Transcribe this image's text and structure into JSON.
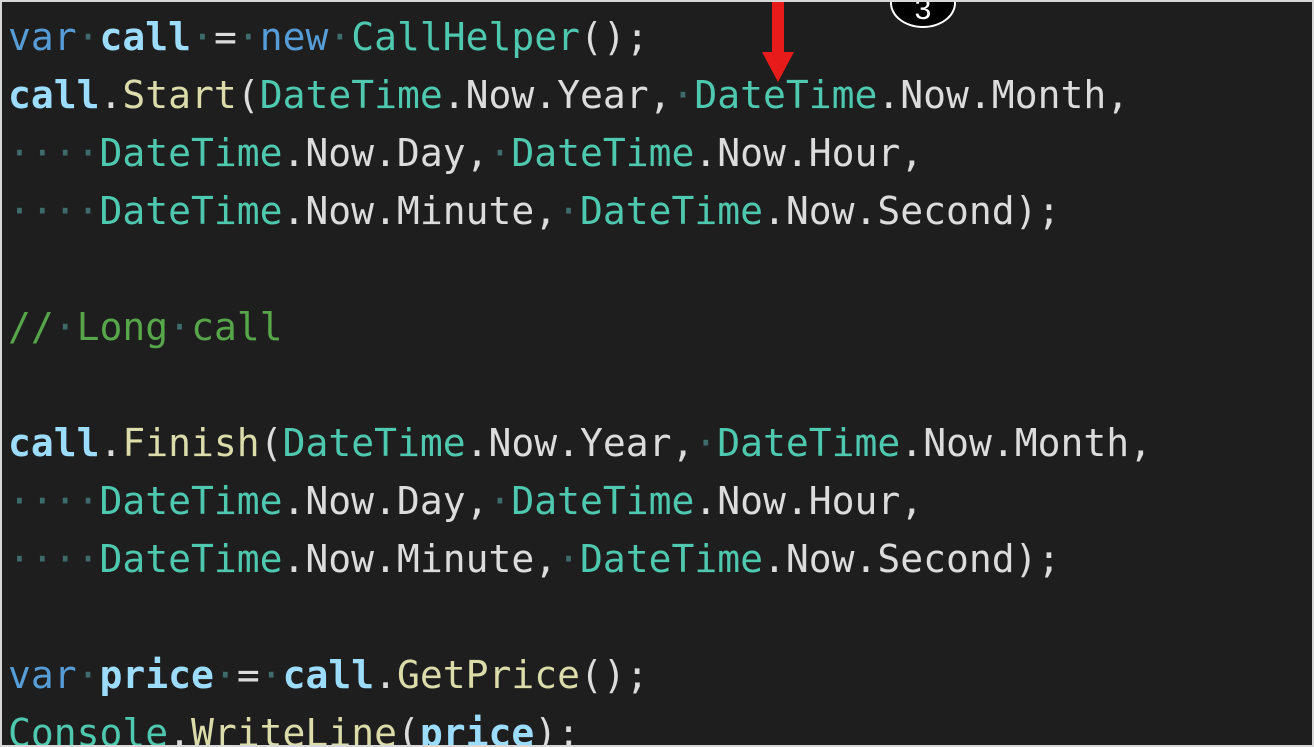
{
  "annotation": {
    "step_number": "3",
    "arrow_color": "#e81b1b"
  },
  "theme": {
    "background": "#1e1e1e",
    "keyword_color": "#569cd6",
    "type_color": "#4ec9b0",
    "variable_color": "#9cdcfe",
    "method_color": "#dcdcaa",
    "comment_color": "#57a64a",
    "whitespace_dot_color": "#3e6c6c"
  },
  "code": {
    "lines": [
      [
        {
          "t": "var",
          "k": "keyword"
        },
        {
          "t": "·",
          "k": "ws"
        },
        {
          "t": "call",
          "k": "variable"
        },
        {
          "t": "·",
          "k": "ws"
        },
        {
          "t": "=",
          "k": "punct"
        },
        {
          "t": "·",
          "k": "ws"
        },
        {
          "t": "new",
          "k": "keyword"
        },
        {
          "t": "·",
          "k": "ws"
        },
        {
          "t": "CallHelper",
          "k": "type"
        },
        {
          "t": "();",
          "k": "punct"
        }
      ],
      [
        {
          "t": "call",
          "k": "variable"
        },
        {
          "t": ".",
          "k": "punct"
        },
        {
          "t": "Start",
          "k": "method"
        },
        {
          "t": "(",
          "k": "punct"
        },
        {
          "t": "DateTime",
          "k": "type"
        },
        {
          "t": ".Now.Year,",
          "k": "property"
        },
        {
          "t": "·",
          "k": "ws"
        },
        {
          "t": "DateTime",
          "k": "type"
        },
        {
          "t": ".Now.Month,",
          "k": "property"
        }
      ],
      [
        {
          "t": "····",
          "k": "ws"
        },
        {
          "t": "DateTime",
          "k": "type"
        },
        {
          "t": ".Now.Day,",
          "k": "property"
        },
        {
          "t": "·",
          "k": "ws"
        },
        {
          "t": "DateTime",
          "k": "type"
        },
        {
          "t": ".Now.Hour,",
          "k": "property"
        }
      ],
      [
        {
          "t": "····",
          "k": "ws"
        },
        {
          "t": "DateTime",
          "k": "type"
        },
        {
          "t": ".Now.Minute,",
          "k": "property"
        },
        {
          "t": "·",
          "k": "ws"
        },
        {
          "t": "DateTime",
          "k": "type"
        },
        {
          "t": ".Now.Second);",
          "k": "property"
        }
      ],
      [],
      [
        {
          "t": "//",
          "k": "comment"
        },
        {
          "t": "·",
          "k": "ws"
        },
        {
          "t": "Long",
          "k": "comment"
        },
        {
          "t": "·",
          "k": "ws"
        },
        {
          "t": "call",
          "k": "comment"
        }
      ],
      [],
      [
        {
          "t": "call",
          "k": "variable"
        },
        {
          "t": ".",
          "k": "punct"
        },
        {
          "t": "Finish",
          "k": "method"
        },
        {
          "t": "(",
          "k": "punct"
        },
        {
          "t": "DateTime",
          "k": "type"
        },
        {
          "t": ".Now.Year,",
          "k": "property"
        },
        {
          "t": "·",
          "k": "ws"
        },
        {
          "t": "DateTime",
          "k": "type"
        },
        {
          "t": ".Now.Month,",
          "k": "property"
        }
      ],
      [
        {
          "t": "····",
          "k": "ws"
        },
        {
          "t": "DateTime",
          "k": "type"
        },
        {
          "t": ".Now.Day,",
          "k": "property"
        },
        {
          "t": "·",
          "k": "ws"
        },
        {
          "t": "DateTime",
          "k": "type"
        },
        {
          "t": ".Now.Hour,",
          "k": "property"
        }
      ],
      [
        {
          "t": "····",
          "k": "ws"
        },
        {
          "t": "DateTime",
          "k": "type"
        },
        {
          "t": ".Now.Minute,",
          "k": "property"
        },
        {
          "t": "·",
          "k": "ws"
        },
        {
          "t": "DateTime",
          "k": "type"
        },
        {
          "t": ".Now.Second);",
          "k": "property"
        }
      ],
      [],
      [
        {
          "t": "var",
          "k": "keyword"
        },
        {
          "t": "·",
          "k": "ws"
        },
        {
          "t": "price",
          "k": "variable"
        },
        {
          "t": "·",
          "k": "ws"
        },
        {
          "t": "=",
          "k": "punct"
        },
        {
          "t": "·",
          "k": "ws"
        },
        {
          "t": "call",
          "k": "variable"
        },
        {
          "t": ".",
          "k": "punct"
        },
        {
          "t": "GetPrice",
          "k": "method"
        },
        {
          "t": "();",
          "k": "punct"
        }
      ],
      [
        {
          "t": "Console",
          "k": "type"
        },
        {
          "t": ".",
          "k": "punct"
        },
        {
          "t": "WriteLine",
          "k": "method"
        },
        {
          "t": "(",
          "k": "punct"
        },
        {
          "t": "price",
          "k": "variable"
        },
        {
          "t": ");",
          "k": "punct"
        }
      ]
    ]
  }
}
